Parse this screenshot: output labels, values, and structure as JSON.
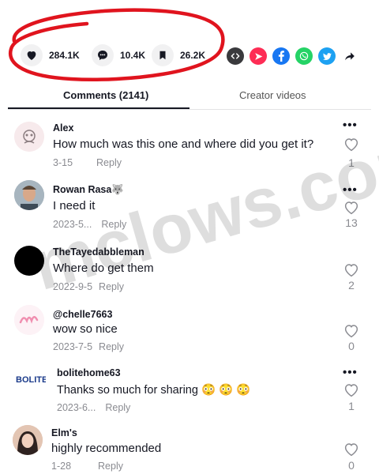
{
  "stats": {
    "likes": "284.1K",
    "comments": "10.4K",
    "saves": "26.2K"
  },
  "share_icons": [
    "embed-icon",
    "send-icon",
    "facebook-icon",
    "whatsapp-icon",
    "twitter-icon",
    "share-arrow-icon"
  ],
  "tabs": {
    "comments": "Comments (2141)",
    "creator": "Creator videos"
  },
  "comments": [
    {
      "user": "Alex",
      "text": "How much was this one and where did you get it?",
      "date": "3-15",
      "reply": "Reply",
      "likes": "1"
    },
    {
      "user": "Rowan Rasa🐺",
      "text": "I need it",
      "date": "2023-5...",
      "reply": "Reply",
      "likes": "13"
    },
    {
      "user": "TheTayedabbleman",
      "text": "Where do get them",
      "date": "2022-9-5",
      "reply": "Reply",
      "likes": "2"
    },
    {
      "user": "@chelle7663",
      "text": "wow so nice",
      "date": "2023-7-5",
      "reply": "Reply",
      "likes": "0"
    },
    {
      "user": "bolitehome63",
      "text": "Thanks so much for sharing 😳 😳 😳",
      "date": "2023-6...",
      "reply": "Reply",
      "likes": "1"
    },
    {
      "user": "Elm's",
      "text": "highly recommended",
      "date": "1-28",
      "reply": "Reply",
      "likes": "0"
    }
  ],
  "avatar_texts": {
    "bolite": "BOLITE"
  },
  "watermark": "mclows.com",
  "colors": {
    "annotation_red": "#e0141e",
    "embed": "#3a3a3d",
    "send": "#fe2c55",
    "facebook": "#1877f2",
    "whatsapp": "#25d366",
    "twitter": "#1da1f2"
  }
}
